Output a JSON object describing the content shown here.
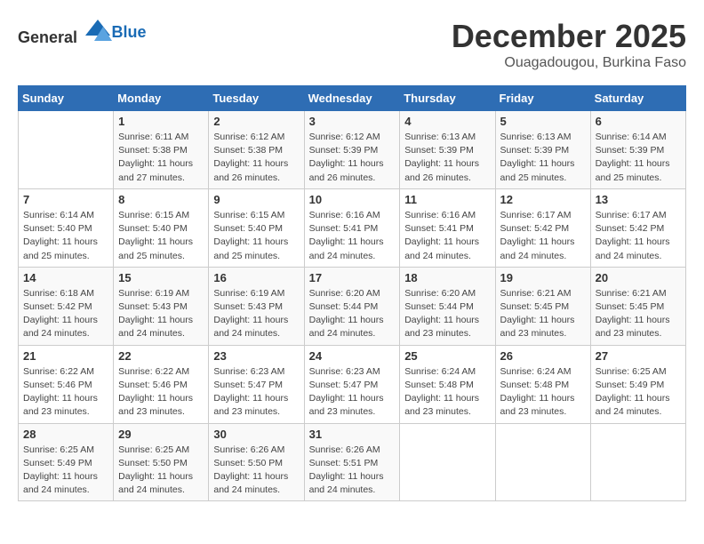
{
  "logo": {
    "general": "General",
    "blue": "Blue"
  },
  "title": {
    "month_year": "December 2025",
    "location": "Ouagadougou, Burkina Faso"
  },
  "headers": [
    "Sunday",
    "Monday",
    "Tuesday",
    "Wednesday",
    "Thursday",
    "Friday",
    "Saturday"
  ],
  "weeks": [
    [
      {
        "num": "",
        "info": ""
      },
      {
        "num": "1",
        "info": "Sunrise: 6:11 AM\nSunset: 5:38 PM\nDaylight: 11 hours and 27 minutes."
      },
      {
        "num": "2",
        "info": "Sunrise: 6:12 AM\nSunset: 5:38 PM\nDaylight: 11 hours and 26 minutes."
      },
      {
        "num": "3",
        "info": "Sunrise: 6:12 AM\nSunset: 5:39 PM\nDaylight: 11 hours and 26 minutes."
      },
      {
        "num": "4",
        "info": "Sunrise: 6:13 AM\nSunset: 5:39 PM\nDaylight: 11 hours and 26 minutes."
      },
      {
        "num": "5",
        "info": "Sunrise: 6:13 AM\nSunset: 5:39 PM\nDaylight: 11 hours and 25 minutes."
      },
      {
        "num": "6",
        "info": "Sunrise: 6:14 AM\nSunset: 5:39 PM\nDaylight: 11 hours and 25 minutes."
      }
    ],
    [
      {
        "num": "7",
        "info": "Sunrise: 6:14 AM\nSunset: 5:40 PM\nDaylight: 11 hours and 25 minutes."
      },
      {
        "num": "8",
        "info": "Sunrise: 6:15 AM\nSunset: 5:40 PM\nDaylight: 11 hours and 25 minutes."
      },
      {
        "num": "9",
        "info": "Sunrise: 6:15 AM\nSunset: 5:40 PM\nDaylight: 11 hours and 25 minutes."
      },
      {
        "num": "10",
        "info": "Sunrise: 6:16 AM\nSunset: 5:41 PM\nDaylight: 11 hours and 24 minutes."
      },
      {
        "num": "11",
        "info": "Sunrise: 6:16 AM\nSunset: 5:41 PM\nDaylight: 11 hours and 24 minutes."
      },
      {
        "num": "12",
        "info": "Sunrise: 6:17 AM\nSunset: 5:42 PM\nDaylight: 11 hours and 24 minutes."
      },
      {
        "num": "13",
        "info": "Sunrise: 6:17 AM\nSunset: 5:42 PM\nDaylight: 11 hours and 24 minutes."
      }
    ],
    [
      {
        "num": "14",
        "info": "Sunrise: 6:18 AM\nSunset: 5:42 PM\nDaylight: 11 hours and 24 minutes."
      },
      {
        "num": "15",
        "info": "Sunrise: 6:19 AM\nSunset: 5:43 PM\nDaylight: 11 hours and 24 minutes."
      },
      {
        "num": "16",
        "info": "Sunrise: 6:19 AM\nSunset: 5:43 PM\nDaylight: 11 hours and 24 minutes."
      },
      {
        "num": "17",
        "info": "Sunrise: 6:20 AM\nSunset: 5:44 PM\nDaylight: 11 hours and 24 minutes."
      },
      {
        "num": "18",
        "info": "Sunrise: 6:20 AM\nSunset: 5:44 PM\nDaylight: 11 hours and 23 minutes."
      },
      {
        "num": "19",
        "info": "Sunrise: 6:21 AM\nSunset: 5:45 PM\nDaylight: 11 hours and 23 minutes."
      },
      {
        "num": "20",
        "info": "Sunrise: 6:21 AM\nSunset: 5:45 PM\nDaylight: 11 hours and 23 minutes."
      }
    ],
    [
      {
        "num": "21",
        "info": "Sunrise: 6:22 AM\nSunset: 5:46 PM\nDaylight: 11 hours and 23 minutes."
      },
      {
        "num": "22",
        "info": "Sunrise: 6:22 AM\nSunset: 5:46 PM\nDaylight: 11 hours and 23 minutes."
      },
      {
        "num": "23",
        "info": "Sunrise: 6:23 AM\nSunset: 5:47 PM\nDaylight: 11 hours and 23 minutes."
      },
      {
        "num": "24",
        "info": "Sunrise: 6:23 AM\nSunset: 5:47 PM\nDaylight: 11 hours and 23 minutes."
      },
      {
        "num": "25",
        "info": "Sunrise: 6:24 AM\nSunset: 5:48 PM\nDaylight: 11 hours and 23 minutes."
      },
      {
        "num": "26",
        "info": "Sunrise: 6:24 AM\nSunset: 5:48 PM\nDaylight: 11 hours and 23 minutes."
      },
      {
        "num": "27",
        "info": "Sunrise: 6:25 AM\nSunset: 5:49 PM\nDaylight: 11 hours and 24 minutes."
      }
    ],
    [
      {
        "num": "28",
        "info": "Sunrise: 6:25 AM\nSunset: 5:49 PM\nDaylight: 11 hours and 24 minutes."
      },
      {
        "num": "29",
        "info": "Sunrise: 6:25 AM\nSunset: 5:50 PM\nDaylight: 11 hours and 24 minutes."
      },
      {
        "num": "30",
        "info": "Sunrise: 6:26 AM\nSunset: 5:50 PM\nDaylight: 11 hours and 24 minutes."
      },
      {
        "num": "31",
        "info": "Sunrise: 6:26 AM\nSunset: 5:51 PM\nDaylight: 11 hours and 24 minutes."
      },
      {
        "num": "",
        "info": ""
      },
      {
        "num": "",
        "info": ""
      },
      {
        "num": "",
        "info": ""
      }
    ]
  ]
}
